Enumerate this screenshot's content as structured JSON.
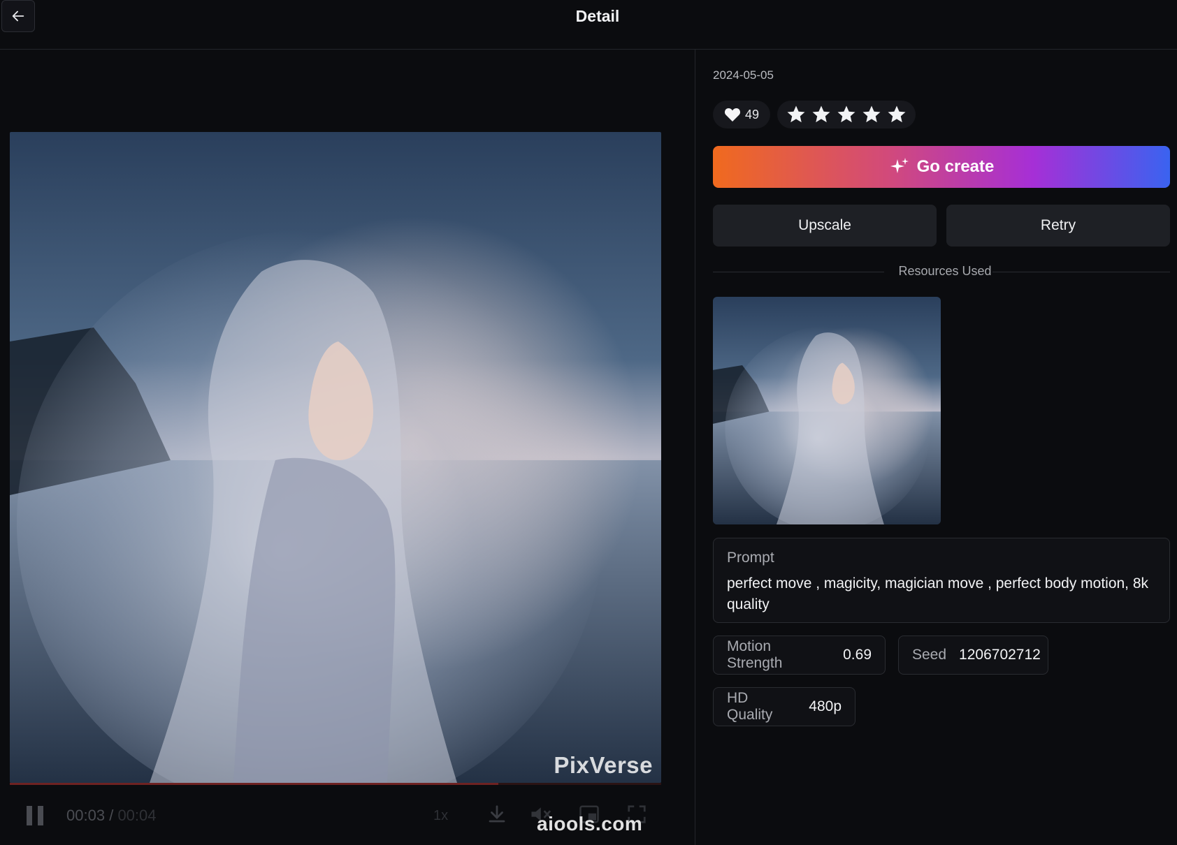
{
  "header": {
    "title": "Detail",
    "back_icon": "arrow-left-icon"
  },
  "player": {
    "watermark": "PixVerse",
    "time_current": "00:03",
    "time_separator": "/",
    "time_total": "00:04",
    "speed": "1x",
    "progress_fraction": 0.75,
    "icons": [
      "pause-icon",
      "download-icon",
      "mute-icon",
      "pip-icon",
      "fullscreen-icon"
    ]
  },
  "site_watermark": "aiools.com",
  "details": {
    "date": "2024-05-05",
    "likes": "49",
    "rating_stars": 5,
    "go_create_label": "Go create",
    "upscale_label": "Upscale",
    "retry_label": "Retry",
    "resources_label": "Resources Used",
    "prompt_label": "Prompt",
    "prompt_text": "perfect move , magicity, magician move , perfect body motion, 8k quality",
    "params": {
      "motion_strength_label": "Motion Strength",
      "motion_strength_value": "0.69",
      "seed_label": "Seed",
      "seed_value": "1206702712",
      "hd_quality_label": "HD Quality",
      "hd_quality_value": "480p"
    }
  },
  "colors": {
    "background": "#0b0c0f",
    "gradient_start": "#f06a1e",
    "gradient_mid": "#a62fd6",
    "gradient_end": "#3a63f0",
    "button_secondary": "#1e2025"
  }
}
